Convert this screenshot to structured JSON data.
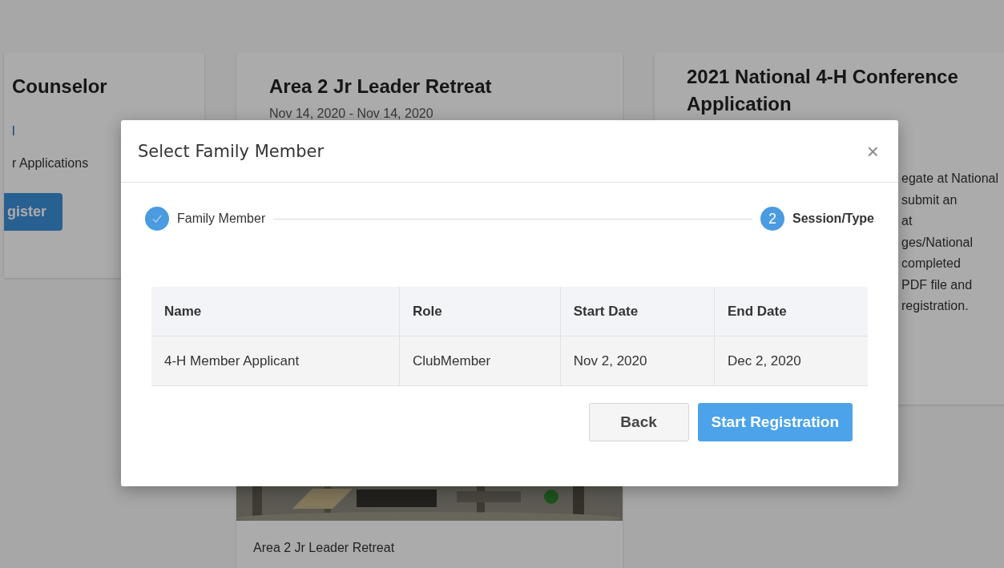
{
  "background_cards": [
    {
      "kind": "left",
      "title": "Counselor",
      "link": "l",
      "text": "r Applications",
      "button": "gister"
    },
    {
      "kind": "middle",
      "title": "Area 2 Jr Leader Retreat",
      "dates": "Nov 14, 2020 - Nov 14, 2020",
      "caption": "Area 2 Jr Leader Retreat"
    },
    {
      "kind": "right",
      "title": "2021 National 4-H Conference Application",
      "lines": [
        "egate at National",
        "submit an",
        "at",
        "ges/National",
        "completed",
        "PDF file and",
        "registration."
      ]
    }
  ],
  "dialog": {
    "title": "Select Family Member",
    "close": "×",
    "steps": [
      {
        "label": "Family Member",
        "completed": true
      },
      {
        "label": "Session/Type",
        "completed": false,
        "number": "2"
      }
    ],
    "table": {
      "columns": [
        "Name",
        "Role",
        "Start Date",
        "End Date"
      ],
      "rows": [
        [
          "4-H Member Applicant",
          "ClubMember",
          "Nov 2, 2020",
          "Dec 2, 2020"
        ]
      ]
    },
    "buttons": [
      {
        "label": "Back",
        "kind": "secondary"
      },
      {
        "label": "Start Registration",
        "kind": "primary"
      }
    ]
  }
}
